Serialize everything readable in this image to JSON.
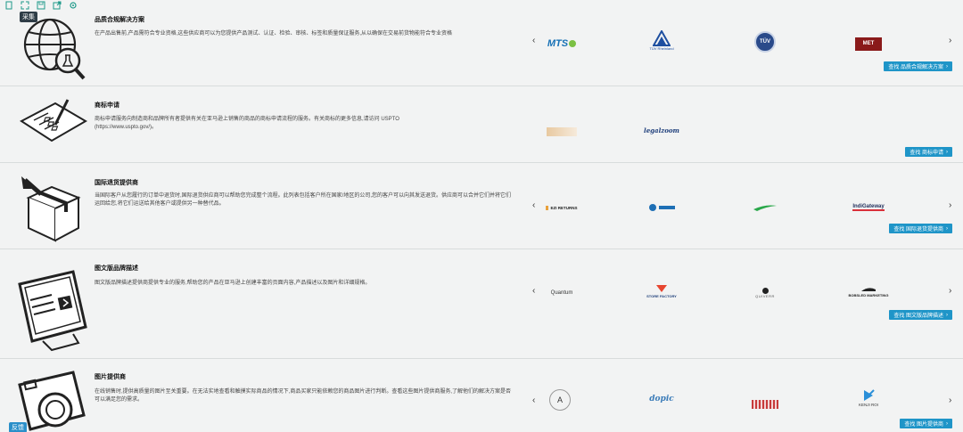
{
  "toolbar": {
    "icons": [
      "document-icon",
      "expand-icon",
      "save-icon",
      "export-icon",
      "settings-icon"
    ],
    "tag_top": "采集",
    "tag_bottom": "反馈"
  },
  "sections": [
    {
      "title": "品质合规解决方案",
      "desc": "在产品出售前,产品需符合专业资格,这些供应商可以为您提供产品测试、认证、检验、审核、标签和质量保证服务,从以确保在交易前货物能符合专业资格",
      "button": "查找 品质合规解决方案",
      "logos": [
        {
          "name": "mts-logo",
          "text": "MTS"
        },
        {
          "name": "tuv-rheinland-logo",
          "text": "TÜV Rheinland"
        },
        {
          "name": "tuv-logo",
          "text": "TÜV"
        },
        {
          "name": "met-logo",
          "text": "MET"
        }
      ]
    },
    {
      "title": "商标申请",
      "desc": "商标申请服务向制造商和品牌所有者提供有关在亚马逊上销售的商品的商标申请流程的服务。有关商标的更多信息,请访问 USPTO (https://www.uspto.gov/)。",
      "button": "查找 商标申请",
      "logos": [
        {
          "name": "trademark-logo",
          "text": ""
        },
        {
          "name": "legalzoom-logo",
          "text": "legalzoom"
        }
      ]
    },
    {
      "title": "国际退货提供商",
      "desc": "当国际客户从您履行的订单中退货时,国际退货供应商可以帮助您完成整个流程。此列表包括客户所在国家/地区的公司,您的客户可以向其发送退货。供应商可以合并它们并将它们运回给您,将它们运送给其他客户或提供另一种替代品。",
      "button": "查找 国际退货提供商",
      "logos": [
        {
          "name": "ezi-returns-logo",
          "text": "EZI RETURNS"
        },
        {
          "name": "returns-logo",
          "text": ""
        },
        {
          "name": "swoosh-logo",
          "text": ""
        },
        {
          "name": "indigateway-logo",
          "text": "IndiGateway"
        }
      ]
    },
    {
      "title": "图文版品牌描述",
      "desc": "图文版品牌描述提供商提供专业的服务,帮助您的产品在亚马逊上创建丰富的页面内容,产品描述以及图片和详细规格。",
      "button": "查找 图文版品牌描述",
      "logos": [
        {
          "name": "quantum-logo",
          "text": "Quantum"
        },
        {
          "name": "store-factory-logo",
          "text": "STORE FACTORY"
        },
        {
          "name": "quiverr-logo",
          "text": "QUIVERR"
        },
        {
          "name": "bobsled-logo",
          "text": "BOBSLED MARKETING"
        }
      ]
    },
    {
      "title": "图片提供商",
      "desc": "在线销售时,提供高质量的图片至关重要。在无法实地查看和触摸实际商品的情况下,商品买家只能依赖您的商品图片进行判断。查看这些图片提供商服务,了解他们的解决方案是否可以满足您的需求。",
      "button": "查找 图片提供商",
      "logos": [
        {
          "name": "a-logo",
          "text": ""
        },
        {
          "name": "dopic-logo",
          "text": "dopic"
        },
        {
          "name": "striped-logo",
          "text": ""
        },
        {
          "name": "kenji-roi-logo",
          "text": "KENJI ROI"
        }
      ]
    }
  ],
  "arrows": {
    "left": "‹",
    "right": "›"
  },
  "colors": {
    "accent": "#1f95c8",
    "background": "#f2f3f3"
  }
}
